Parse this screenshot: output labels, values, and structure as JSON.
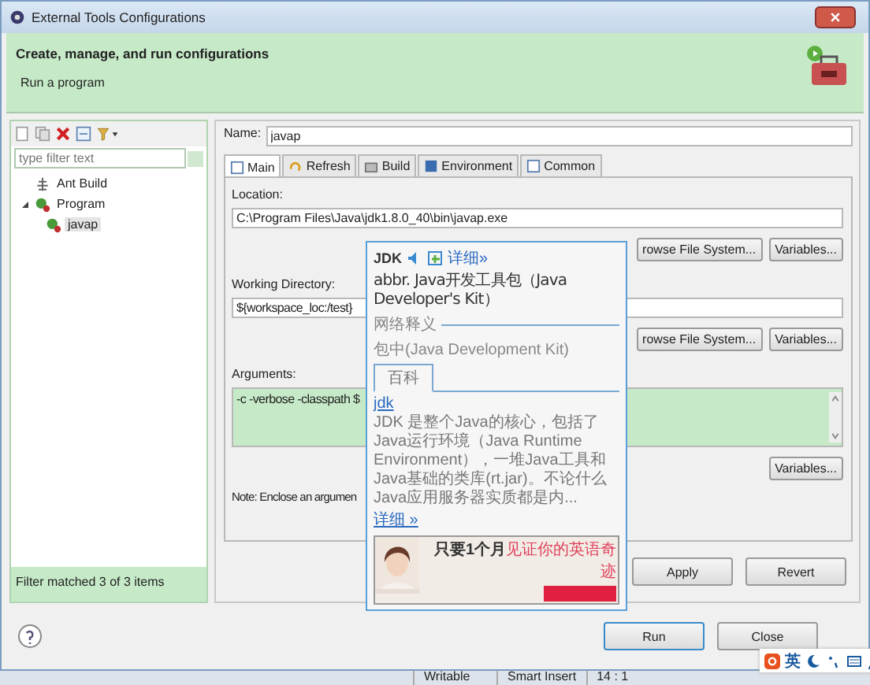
{
  "window": {
    "title": "External Tools Configurations"
  },
  "header": {
    "title": "Create, manage, and run configurations",
    "message": "Run a program"
  },
  "filter": {
    "placeholder": "type filter text"
  },
  "tree": [
    {
      "label": "Ant Build",
      "kind": "ant",
      "selected": false
    },
    {
      "label": "Program",
      "kind": "program",
      "selected": false,
      "expanded": true,
      "children": [
        {
          "label": "javap",
          "kind": "config",
          "selected": true
        }
      ]
    }
  ],
  "filter_status": "Filter matched 3 of 3 items",
  "name": {
    "label": "Name:",
    "value": "javap"
  },
  "tabs": [
    {
      "label": "Main",
      "kind": "page",
      "selected": true
    },
    {
      "label": "Refresh",
      "kind": "refresh",
      "selected": false
    },
    {
      "label": "Build",
      "kind": "build",
      "selected": false
    },
    {
      "label": "Environment",
      "kind": "env",
      "selected": false
    },
    {
      "label": "Common",
      "kind": "page",
      "selected": false
    }
  ],
  "location": {
    "label": "Location:",
    "value": "C:\\Program Files\\Java\\jdk1.8.0_40\\bin\\javap.exe",
    "buttons": [
      "rowse File System...",
      "Variables..."
    ]
  },
  "working_directory": {
    "label": "Working Directory:",
    "value": "${workspace_loc:/test}",
    "buttons": [
      "rowse File System...",
      "Variables..."
    ]
  },
  "arguments": {
    "label": "Arguments:",
    "value": "-c -verbose -classpath  $",
    "buttons": [
      "Variables..."
    ],
    "note": "Note: Enclose an argumen"
  },
  "actions": [
    "Apply",
    "Revert"
  ],
  "dialog_buttons": [
    {
      "label": "Run",
      "default": true
    },
    {
      "label": "Close",
      "default": false
    }
  ],
  "popup": {
    "word": "JDK",
    "detail_link": "详细»",
    "abbr": "abbr. Java开发工具包（Java Developer's Kit）",
    "section": "网络释义",
    "web_meaning": "包中(Java Development Kit)",
    "tabs": [
      {
        "label": "百科",
        "selected": true
      }
    ],
    "entry_link": "jdk",
    "entry_text": "JDK 是整个Java的核心，包括了Java运行环境（Java Runtime Environment），一堆Java工具和Java基础的类库(rt.jar)。不论什么Java应用服务器实质都是内...",
    "more_link": "详细 »",
    "ad": {
      "headline": "只要1个月",
      "highlight": "见证你的英语奇迹"
    }
  },
  "ime": {
    "label": "英"
  },
  "status_bar": [
    "Writable",
    "Smart Insert",
    "14 : 1"
  ]
}
